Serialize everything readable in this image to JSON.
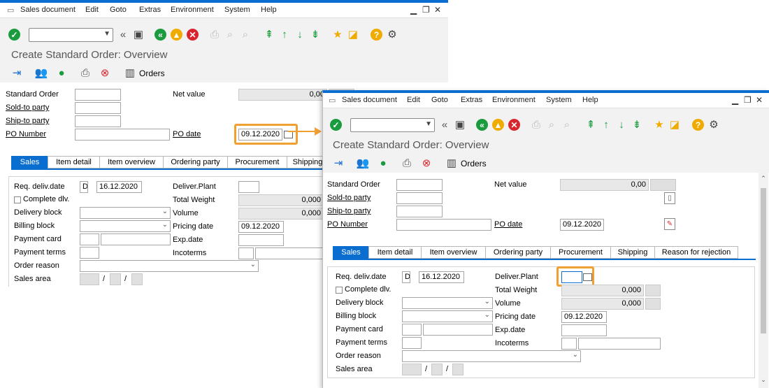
{
  "menu": {
    "items": [
      "Sales document",
      "Edit",
      "Goto",
      "Extras",
      "Environment",
      "System",
      "Help"
    ],
    "minimize": "▁",
    "restore": "❐",
    "close": "✕"
  },
  "title": "Create Standard Order: Overview",
  "app_toolbar": {
    "orders_label": "Orders"
  },
  "header": {
    "standard_order": "Standard Order",
    "sold_to_party": "Sold-to party",
    "ship_to_party": "Ship-to party",
    "po_number": "PO Number",
    "net_value": "Net value",
    "net_value_value": "0,00",
    "po_date": "PO date",
    "po_date_value": "09.12.2020"
  },
  "tabs": [
    "Sales",
    "Item detail",
    "Item overview",
    "Ordering party",
    "Procurement",
    "Shipping",
    "Reason for rejection"
  ],
  "sales": {
    "req_deliv_date": "Req. deliv.date",
    "req_deliv_date_format": "D",
    "req_deliv_date_value": "16.12.2020",
    "complete_dlv": "Complete dlv.",
    "delivery_block": "Delivery block",
    "billing_block": "Billing block",
    "payment_card": "Payment card",
    "payment_terms": "Payment terms",
    "order_reason": "Order reason",
    "sales_area": "Sales area",
    "sales_area_sep": "/",
    "deliver_plant": "Deliver.Plant",
    "total_weight": "Total Weight",
    "total_weight_value": "0,000",
    "volume": "Volume",
    "volume_value": "0,000",
    "pricing_date": "Pricing date",
    "pricing_date_value": "09.12.2020",
    "exp_date": "Exp.date",
    "incoterms": "Incoterms"
  },
  "colors": {
    "accent": "#0a6ed1",
    "highlight": "#f0a030",
    "green": "#1a9c3e",
    "red": "#d9262e",
    "orange": "#f0ab00"
  }
}
